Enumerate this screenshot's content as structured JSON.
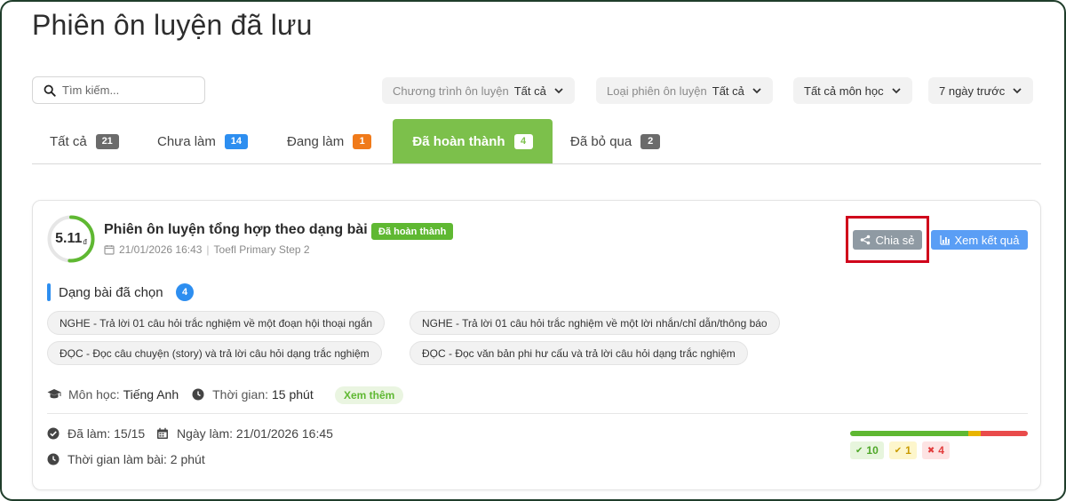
{
  "page": {
    "title": "Phiên ôn luyện đã lưu"
  },
  "search": {
    "placeholder": "Tìm kiếm..."
  },
  "filters": [
    {
      "label": "Chương trình ôn luyện",
      "value": "Tất cả"
    },
    {
      "label": "Loại phiên ôn luyện",
      "value": "Tất cả"
    },
    {
      "label": "",
      "value": "Tất cả môn học"
    },
    {
      "label": "",
      "value": "7 ngày trước"
    }
  ],
  "tabs": [
    {
      "label": "Tất cả",
      "count": "21",
      "color": "#6b6b6b"
    },
    {
      "label": "Chưa làm",
      "count": "14",
      "color": "#2d8ef0"
    },
    {
      "label": "Đang làm",
      "count": "1",
      "color": "#f07a1a"
    },
    {
      "label": "Đã hoàn thành",
      "count": "4",
      "color": "#7cc04b",
      "active": true
    },
    {
      "label": "Đã bỏ qua",
      "count": "2",
      "color": "#6b6b6b"
    }
  ],
  "session": {
    "score": "5.11",
    "score_unit": "đ",
    "score_fraction": 0.51,
    "title": "Phiên ôn luyện tổng hợp theo dạng bài",
    "status": "Đã hoàn thành",
    "date": "21/01/2026 16:43",
    "program": "Toefl Primary Step 2",
    "share_label": "Chia sẻ",
    "result_label": "Xem kết quả",
    "section_title": "Dạng bài đã chọn",
    "section_count": "4",
    "question_types": [
      "NGHE - Trả lời 01 câu hỏi trắc nghiệm về một đoạn hội thoại ngắn",
      "NGHE - Trả lời 01 câu hỏi trắc nghiệm về một lời nhắn/chỉ dẫn/thông báo",
      "ĐỌC - Đọc câu chuyện (story) và trả lời câu hỏi dạng trắc nghiệm",
      "ĐỌC - Đọc văn bản phi hư cấu và trả lời câu hỏi dạng trắc nghiệm"
    ],
    "subject_label": "Môn học:",
    "subject": "Tiếng Anh",
    "time_label": "Thời gian:",
    "time": "15 phút",
    "more_label": "Xem thêm",
    "done_label": "Đã làm:",
    "done": "15/15",
    "date_done_label": "Ngày làm:",
    "date_done": "21/01/2026 16:45",
    "duration_label": "Thời gian làm bài:",
    "duration": "2 phút",
    "correct": "10",
    "partial": "1",
    "wrong": "4"
  },
  "colors": {
    "correct": "#5fb832",
    "partial": "#e8b400",
    "wrong": "#e94b4b"
  }
}
